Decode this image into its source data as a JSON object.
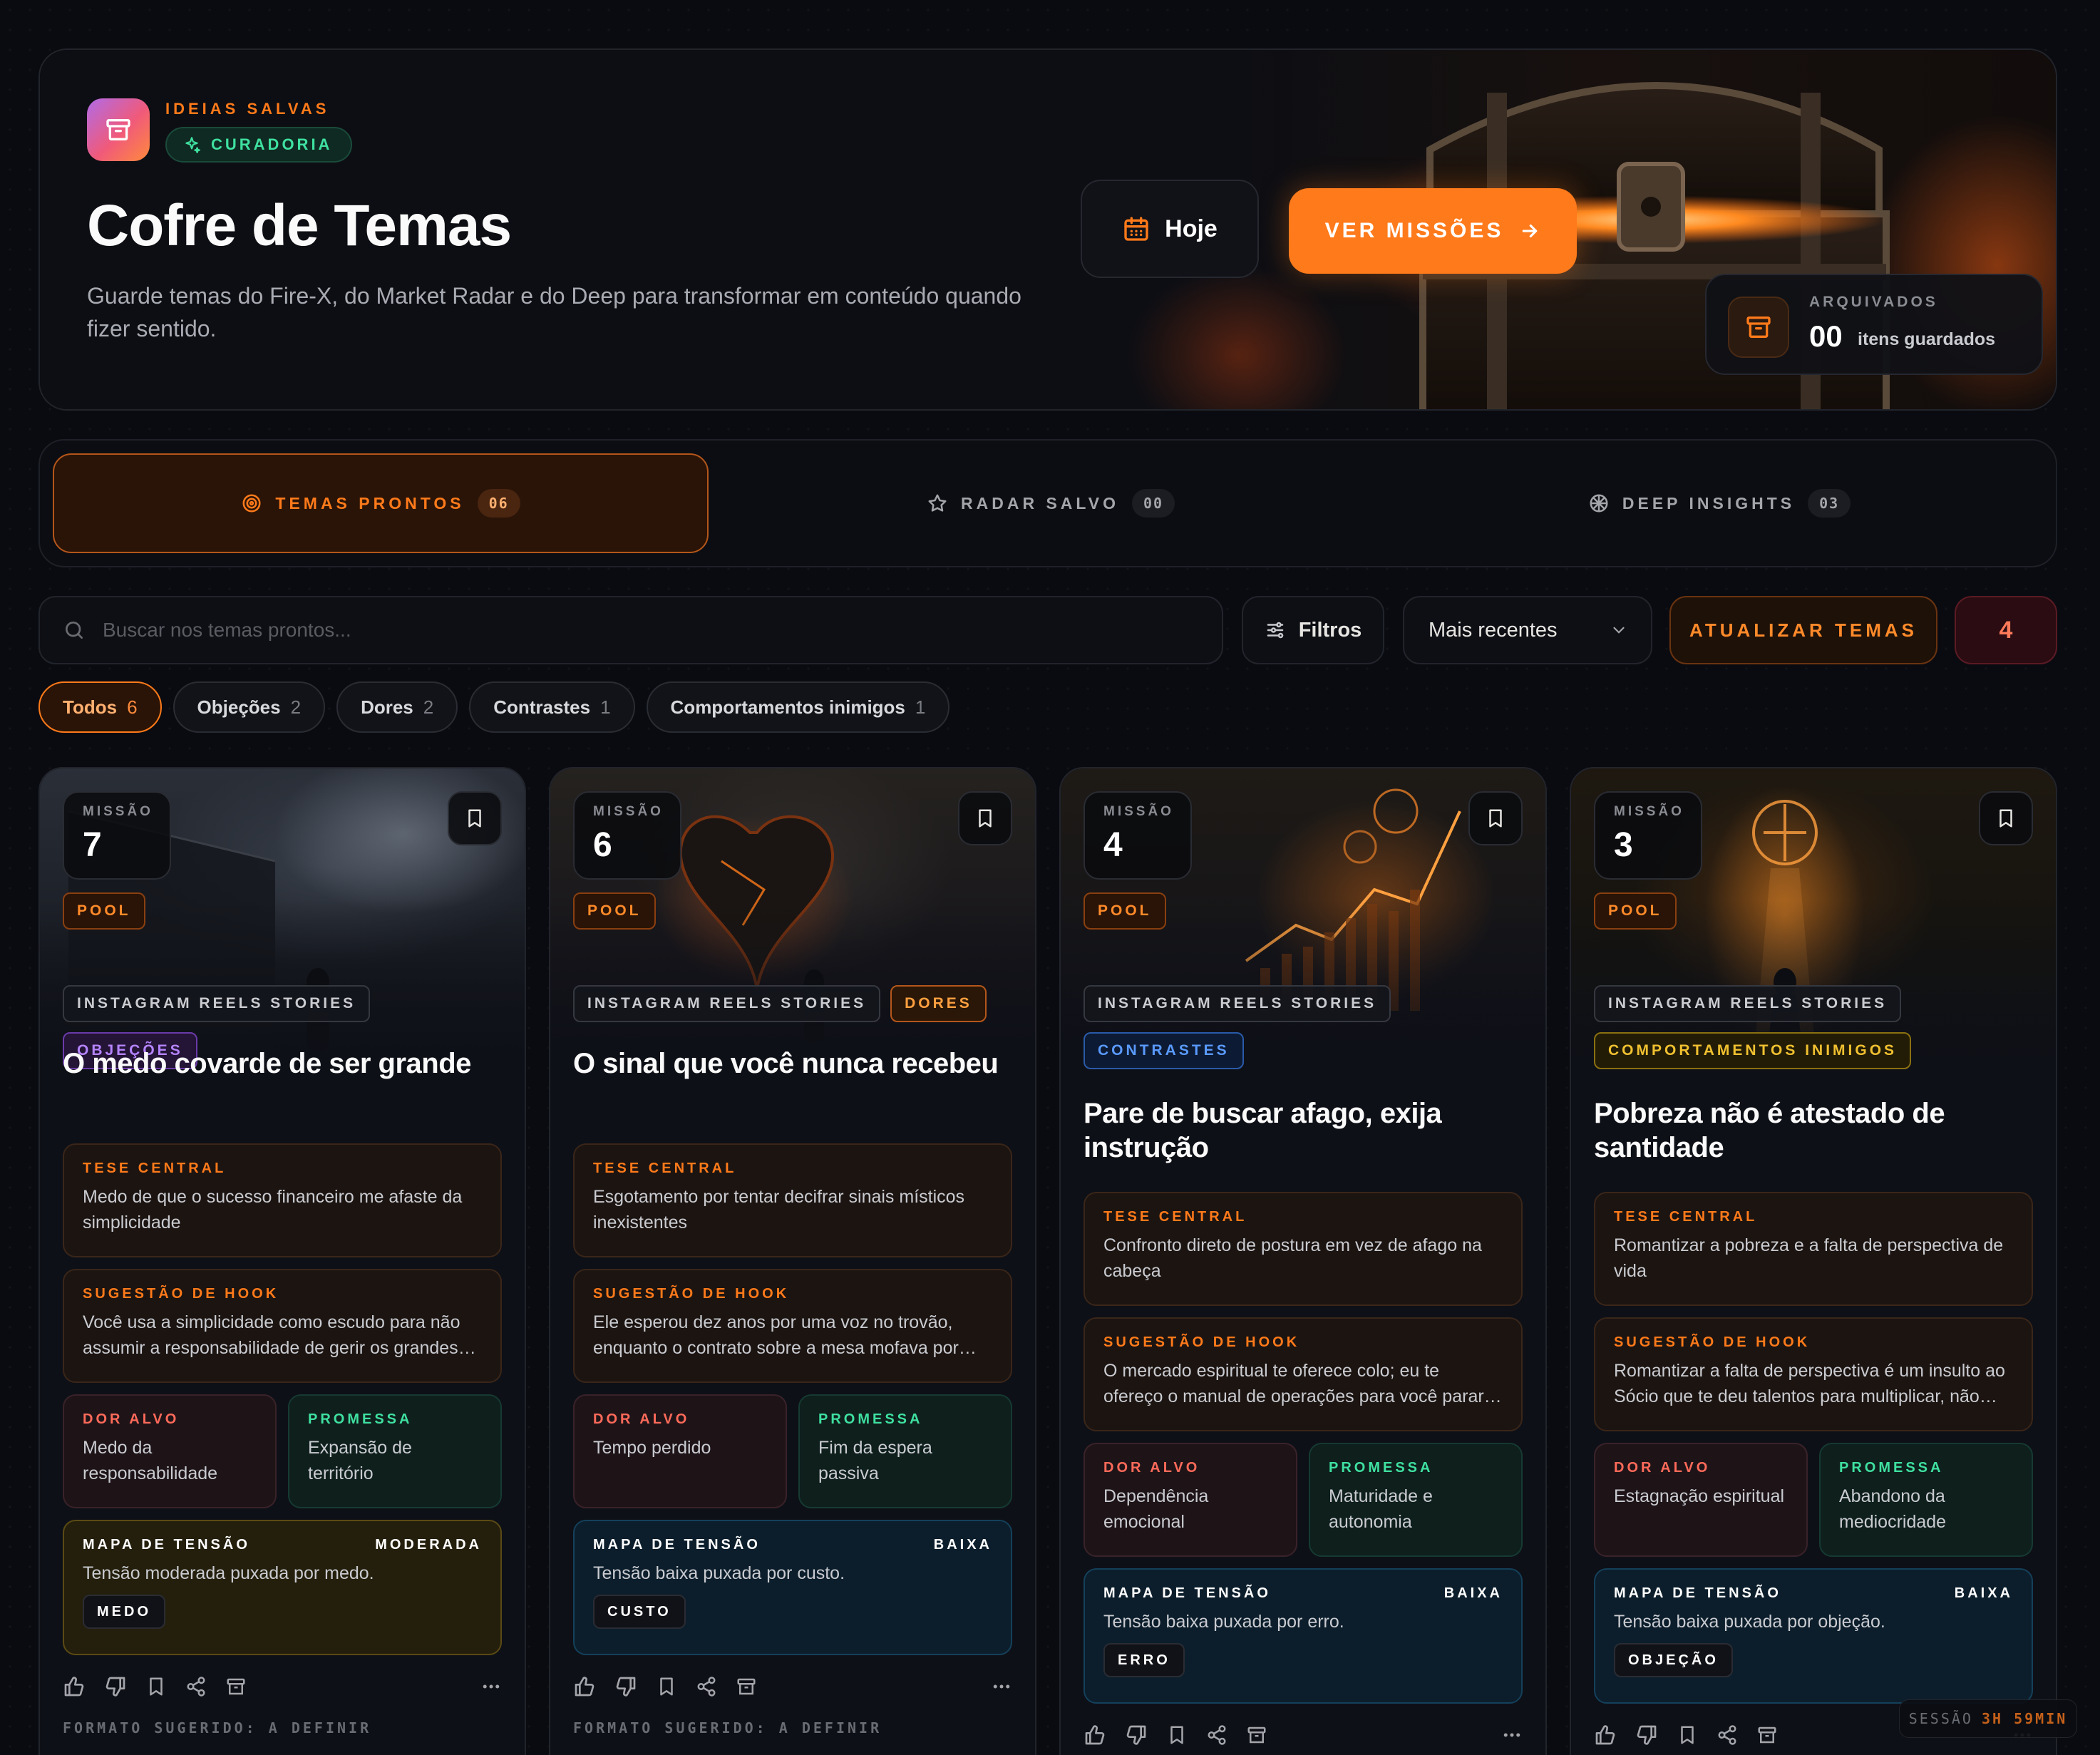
{
  "hero": {
    "eyebrow": "IDEIAS SALVAS",
    "badge": "CURADORIA",
    "title": "Cofre de Temas",
    "description": "Guarde temas do Fire-X, do Market Radar e do Deep para transformar em conteúdo quando fizer sentido.",
    "today_label": "Hoje",
    "missions_label": "VER MISSÕES",
    "archived_label": "ARQUIVADOS",
    "archived_count": "00",
    "archived_text": "itens guardados"
  },
  "tabs": [
    {
      "label": "TEMAS PRONTOS",
      "count": "06",
      "icon": "target-icon"
    },
    {
      "label": "RADAR SALVO",
      "count": "00",
      "icon": "star-icon"
    },
    {
      "label": "DEEP INSIGHTS",
      "count": "03",
      "icon": "brain-icon"
    }
  ],
  "toolbar": {
    "search_placeholder": "Buscar nos temas prontos...",
    "filters_label": "Filtros",
    "sort_value": "Mais recentes",
    "refresh_label": "ATUALIZAR TEMAS",
    "badge_count": "4"
  },
  "chips": [
    {
      "label": "Todos",
      "count": "6"
    },
    {
      "label": "Objeções",
      "count": "2"
    },
    {
      "label": "Dores",
      "count": "2"
    },
    {
      "label": "Contrastes",
      "count": "1"
    },
    {
      "label": "Comportamentos inimigos",
      "count": "1"
    }
  ],
  "cards": [
    {
      "mission_label": "MISSÃO",
      "mission": "7",
      "pool": "POOL",
      "platform": "INSTAGRAM REELS STORIES",
      "category": "OBJEÇÕES",
      "title": "O medo covarde de ser grande",
      "tese_label": "TESE CENTRAL",
      "tese": "Medo de que o sucesso financeiro me afaste da simplicidade",
      "hook_label": "SUGESTÃO DE HOOK",
      "hook": "Você usa a simplicidade como escudo para não assumir a responsabilidade de gerir os grandes recursos que Deus quer te confiar.",
      "dor_label": "DOR ALVO",
      "dor": "Medo da responsabilidade",
      "promessa_label": "PROMESSA",
      "promessa": "Expansão de território",
      "mapa_label": "MAPA DE TENSÃO",
      "mapa_level": "MODERADA",
      "mapa_text": "Tensão moderada puxada por medo.",
      "mapa_key": "MEDO",
      "format": "FORMATO SUGERIDO: A DEFINIR"
    },
    {
      "mission_label": "MISSÃO",
      "mission": "6",
      "pool": "POOL",
      "platform": "INSTAGRAM REELS STORIES",
      "category": "DORES",
      "title": "O sinal que você nunca recebeu",
      "tese_label": "TESE CENTRAL",
      "tese": "Esgotamento por tentar decifrar sinais místicos inexistentes",
      "hook_label": "SUGESTÃO DE HOOK",
      "hook": "Ele esperou dez anos por uma voz no trovão, enquanto o contrato sobre a mesa mofava por falta de assinatura.",
      "dor_label": "DOR ALVO",
      "dor": "Tempo perdido",
      "promessa_label": "PROMESSA",
      "promessa": "Fim da espera passiva",
      "mapa_label": "MAPA DE TENSÃO",
      "mapa_level": "BAIXA",
      "mapa_text": "Tensão baixa puxada por custo.",
      "mapa_key": "CUSTO",
      "format": "FORMATO SUGERIDO: A DEFINIR"
    },
    {
      "mission_label": "MISSÃO",
      "mission": "4",
      "pool": "POOL",
      "platform": "INSTAGRAM REELS STORIES",
      "category": "CONTRASTES",
      "title": "Pare de buscar afago, exija instrução",
      "tese_label": "TESE CENTRAL",
      "tese": "Confronto direto de postura em vez de afago na cabeça",
      "hook_label": "SUGESTÃO DE HOOK",
      "hook": "O mercado espiritual te oferece colo; eu te ofereço o manual de operações para você parar de depender dele.",
      "dor_label": "DOR ALVO",
      "dor": "Dependência emocional",
      "promessa_label": "PROMESSA",
      "promessa": "Maturidade e autonomia",
      "mapa_label": "MAPA DE TENSÃO",
      "mapa_level": "BAIXA",
      "mapa_text": "Tensão baixa puxada por erro.",
      "mapa_key": "ERRO",
      "format": ""
    },
    {
      "mission_label": "MISSÃO",
      "mission": "3",
      "pool": "POOL",
      "platform": "INSTAGRAM REELS STORIES",
      "category": "COMPORTAMENTOS INIMIGOS",
      "title": "Pobreza não é atestado de santidade",
      "tese_label": "TESE CENTRAL",
      "tese": "Romantizar a pobreza e a falta de perspectiva de vida",
      "hook_label": "SUGESTÃO DE HOOK",
      "hook": "Romantizar a falta de perspectiva é um insulto ao Sócio que te deu talentos para multiplicar, não para enterrar.",
      "dor_label": "DOR ALVO",
      "dor": "Estagnação espiritual",
      "promessa_label": "PROMESSA",
      "promessa": "Abandono da mediocridade",
      "mapa_label": "MAPA DE TENSÃO",
      "mapa_level": "BAIXA",
      "mapa_text": "Tensão baixa puxada por objeção.",
      "mapa_key": "OBJEÇÃO",
      "format": ""
    }
  ],
  "session": {
    "label": "SESSÃO",
    "time": "3H 59MIN"
  },
  "colors": {
    "accent": "#ff7a1a",
    "background": "#0a0b10",
    "success": "#3fe0a0"
  }
}
